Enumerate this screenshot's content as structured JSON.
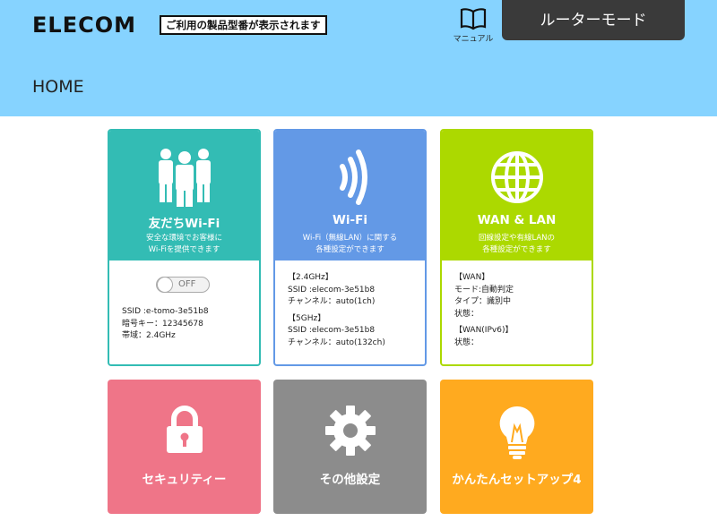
{
  "header": {
    "logo": "ELECOM",
    "tagline": "ご利用の製品型番が表示されます",
    "manual_label": "マニュアル",
    "mode": "ルーターモード",
    "page_title": "HOME"
  },
  "cards": {
    "friend_wifi": {
      "title": "友だちWi-Fi",
      "desc1": "安全な環境でお客様に",
      "desc2": "Wi-Fiを提供できます",
      "toggle": "OFF",
      "ssid": "SSID :e-tomo-3e51b8",
      "key": "暗号キー：12345678",
      "band": "帯域：2.4GHz"
    },
    "wifi": {
      "title": "Wi-Fi",
      "desc1": "Wi-Fi（無線LAN）に関する",
      "desc2": "各種設定ができます",
      "g24_head": "【2.4GHz】",
      "g24_ssid": "SSID :elecom-3e51b8",
      "g24_channel": "チャンネル：auto(1ch)",
      "g5_head": "【5GHz】",
      "g5_ssid": "SSID :elecom-3e51b8",
      "g5_channel": "チャンネル：auto(132ch)"
    },
    "wan_lan": {
      "title": "WAN & LAN",
      "desc1": "回線設定や有線LANの",
      "desc2": "各種設定ができます",
      "wan_head": "【WAN】",
      "wan_mode": "モード:自動判定",
      "wan_type": "タイプ：識別中",
      "wan_state": "状態：",
      "ipv6_head": "【WAN(IPv6)】",
      "ipv6_state": "状態："
    }
  },
  "tiles": {
    "security": "セキュリティー",
    "other": "その他設定",
    "setup": "かんたんセットアップ4"
  },
  "colors": {
    "header_bg": "#86d3ff",
    "friend": "#33bcb4",
    "wifi": "#6399e6",
    "wan": "#acd900",
    "security": "#ef7588",
    "other": "#8c8c8c",
    "setup": "#ffaa1f"
  },
  "icons": {
    "manual": "book-icon",
    "friend": "people-icon",
    "wifi": "wifi-signal-icon",
    "wan": "globe-icon",
    "security": "lock-icon",
    "other": "gear-icon",
    "setup": "lightbulb-icon"
  }
}
